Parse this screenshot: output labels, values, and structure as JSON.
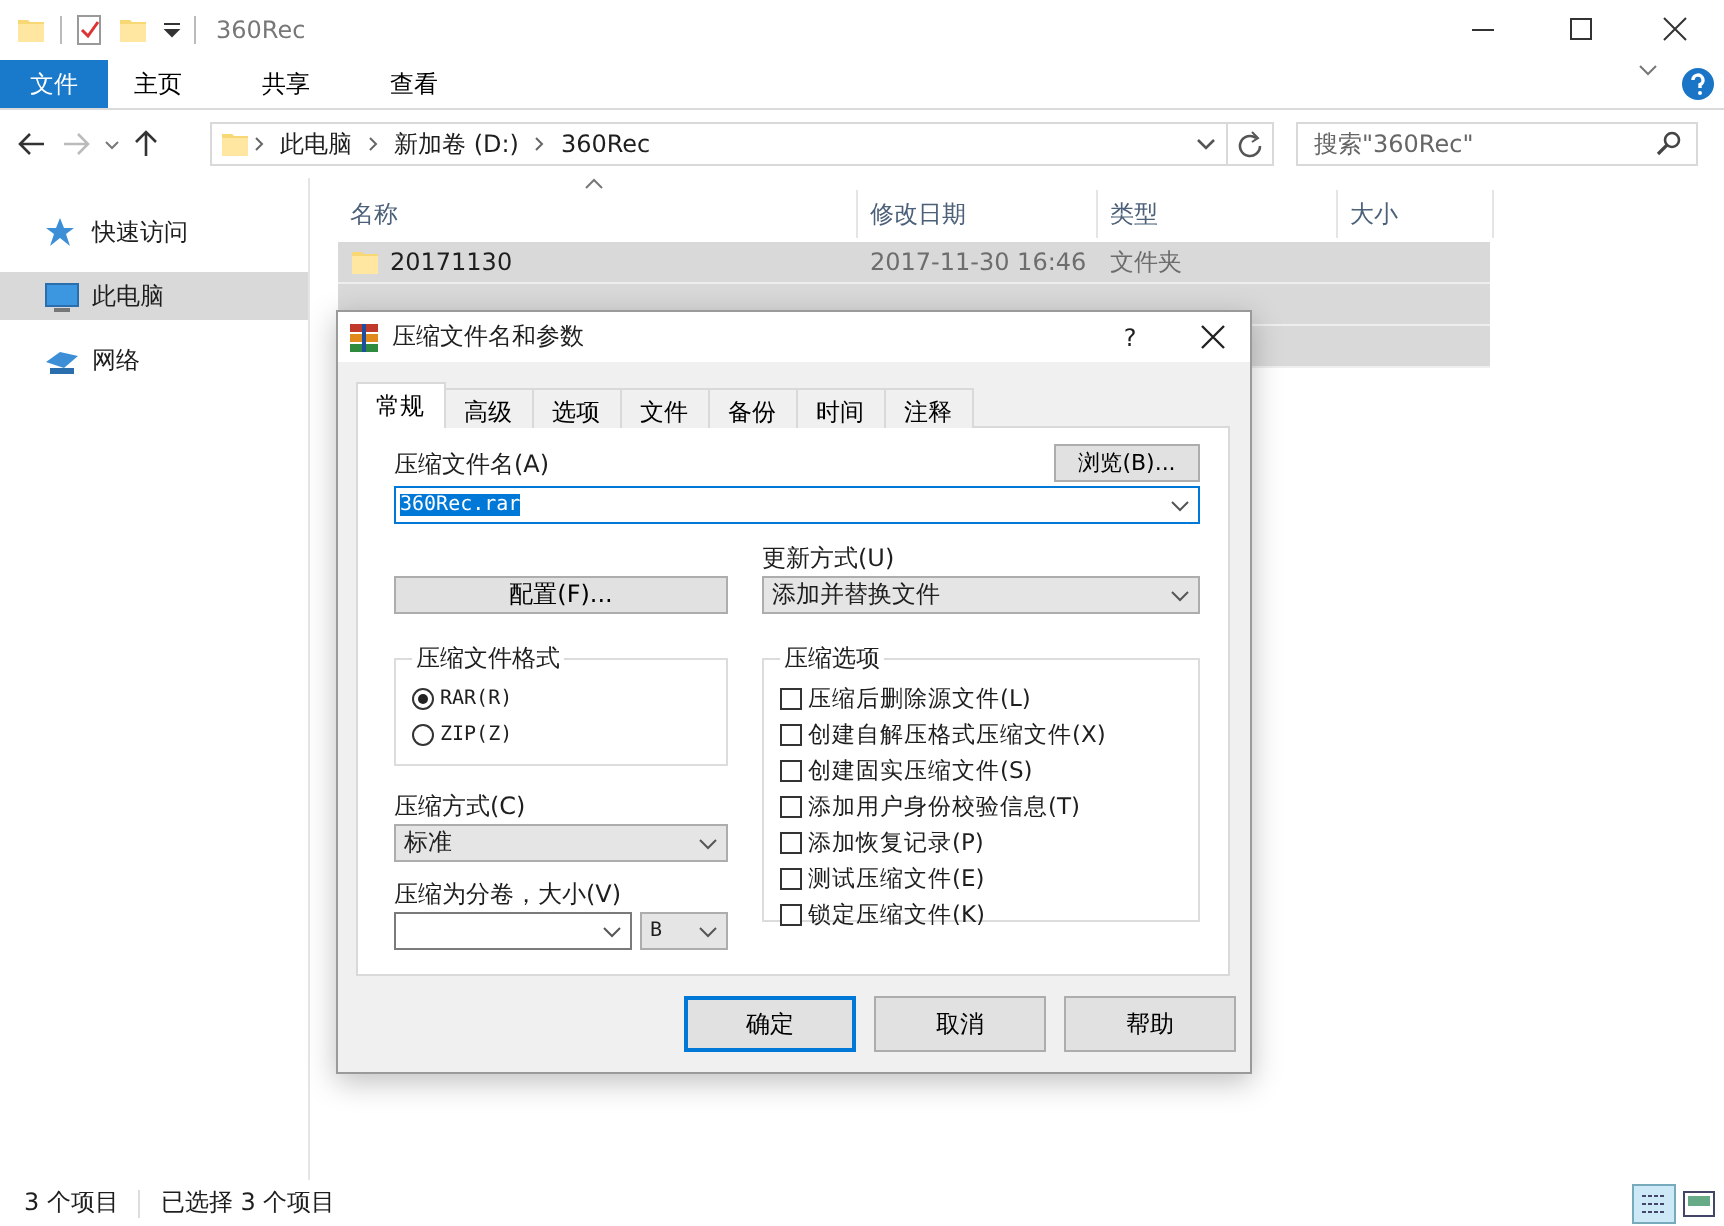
{
  "window": {
    "title": "360Rec"
  },
  "ribbon_tabs": [
    {
      "label": "文件",
      "selected": true
    },
    {
      "label": "主页",
      "selected": false
    },
    {
      "label": "共享",
      "selected": false
    },
    {
      "label": "查看",
      "selected": false
    }
  ],
  "address": {
    "crumbs": [
      "此电脑",
      "新加卷 (D:)",
      "360Rec"
    ]
  },
  "search": {
    "placeholder": "搜索\"360Rec\""
  },
  "sidebar": {
    "items": [
      {
        "kind": "star",
        "label": "快速访问",
        "selected": false
      },
      {
        "kind": "computer",
        "label": "此电脑",
        "selected": true
      },
      {
        "kind": "network",
        "label": "网络",
        "selected": false
      }
    ]
  },
  "table": {
    "columns": [
      "名称",
      "修改日期",
      "类型",
      "大小"
    ],
    "rows": [
      {
        "name": "20171130",
        "date": "2017-11-30 16:46",
        "type": "文件夹",
        "selected": true
      },
      {
        "selected": true
      },
      {
        "selected": true
      }
    ]
  },
  "status_bar": {
    "count": "3 个项目",
    "selection": "已选择 3 个项目"
  },
  "dialog": {
    "title": "压缩文件名和参数",
    "help": "?",
    "tabs": [
      {
        "label": "常规",
        "selected": true
      },
      {
        "label": "高级",
        "selected": false
      },
      {
        "label": "选项",
        "selected": false
      },
      {
        "label": "文件",
        "selected": false
      },
      {
        "label": "备份",
        "selected": false
      },
      {
        "label": "时间",
        "selected": false
      },
      {
        "label": "注释",
        "selected": false
      }
    ],
    "archive_name": {
      "label": "压缩文件名(A)",
      "value": "360Rec.rar"
    },
    "browse_button": "浏览(B)...",
    "profiles_button": "配置(F)...",
    "update_mode": {
      "label": "更新方式(U)",
      "value": "添加并替换文件"
    },
    "format": {
      "label": "压缩文件格式",
      "options": [
        {
          "label": "RAR(R)",
          "selected": true
        },
        {
          "label": "ZIP(Z)",
          "selected": false
        }
      ]
    },
    "method": {
      "label": "压缩方式(C)",
      "value": "标准"
    },
    "split": {
      "label": "压缩为分卷，大小(V)",
      "unit": "B"
    },
    "options": {
      "label": "压缩选项",
      "items": [
        {
          "label": "压缩后删除源文件(L)",
          "checked": false
        },
        {
          "label": "创建自解压格式压缩文件(X)",
          "checked": false
        },
        {
          "label": "创建固实压缩文件(S)",
          "checked": false
        },
        {
          "label": "添加用户身份校验信息(T)",
          "checked": false
        },
        {
          "label": "添加恢复记录(P)",
          "checked": false
        },
        {
          "label": "测试压缩文件(E)",
          "checked": false
        },
        {
          "label": "锁定压缩文件(K)",
          "checked": false
        }
      ]
    },
    "buttons": [
      {
        "label": "确定",
        "default": true
      },
      {
        "label": "取消",
        "default": false
      },
      {
        "label": "帮助",
        "default": false
      }
    ]
  }
}
